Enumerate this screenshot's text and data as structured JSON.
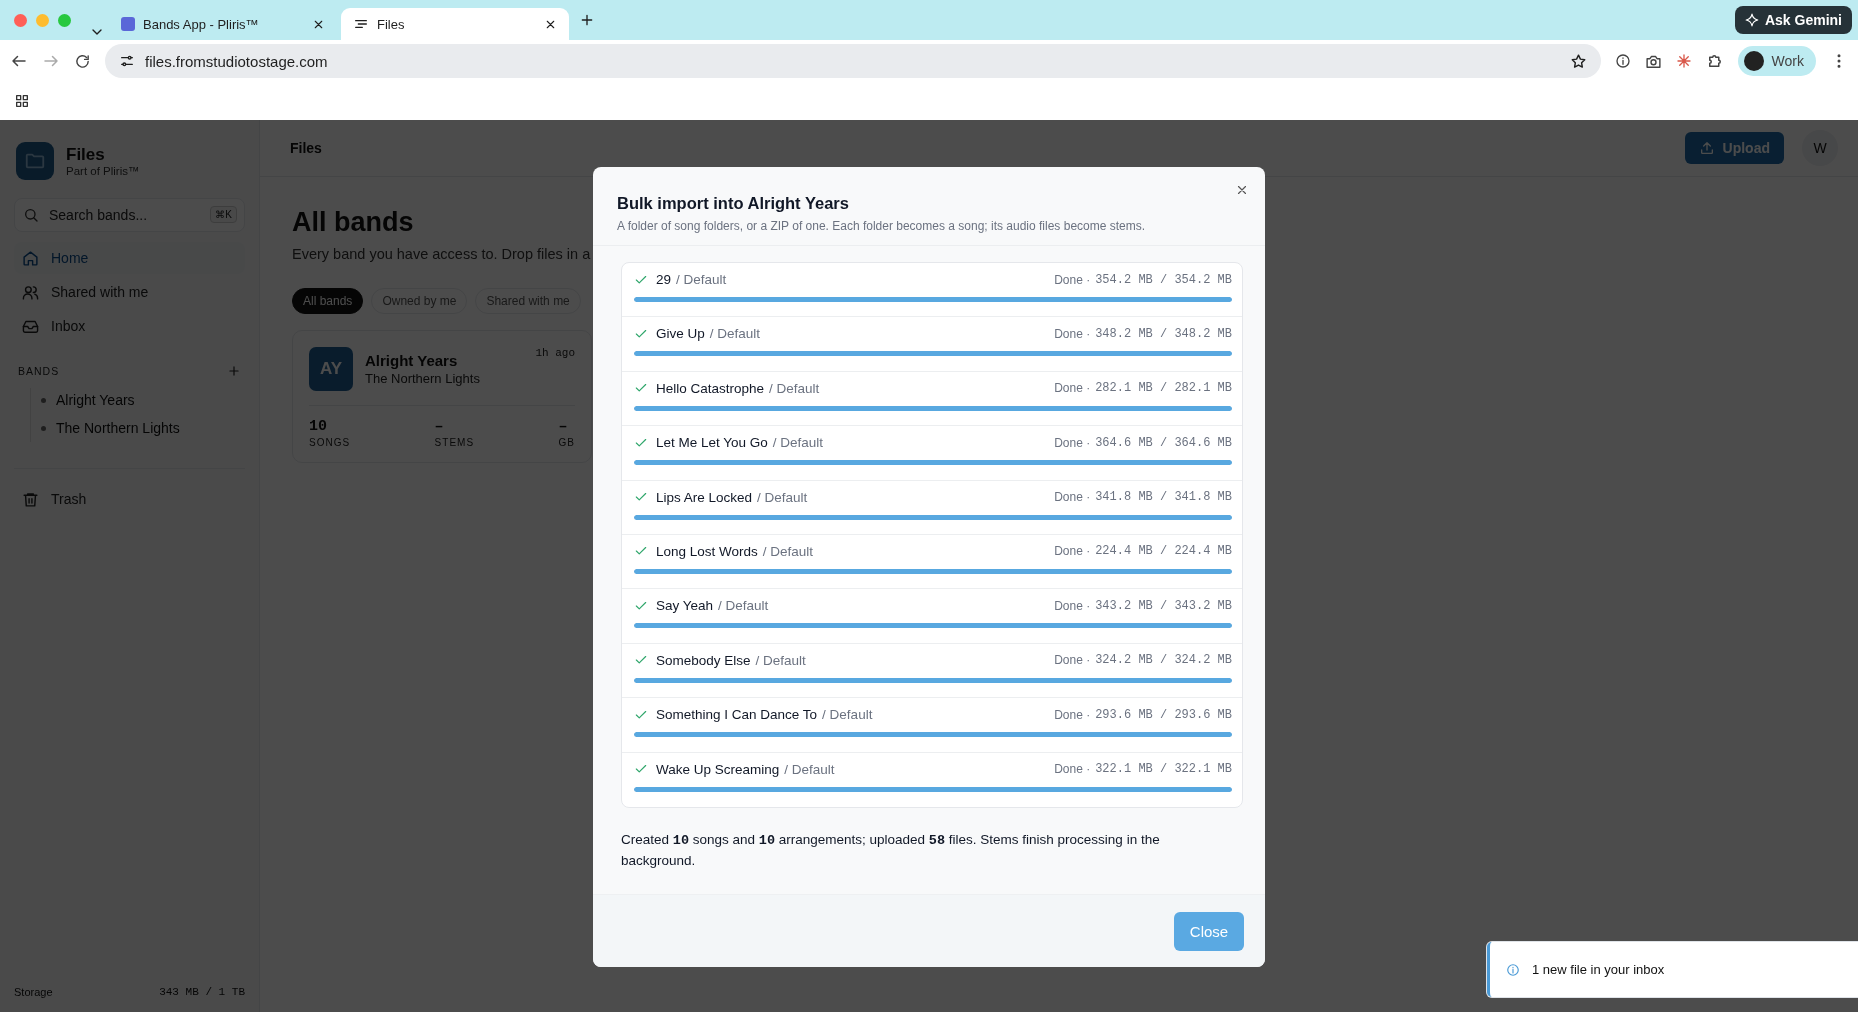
{
  "browser": {
    "tabs": [
      {
        "title": "Bands App - Pliris™",
        "selected": false
      },
      {
        "title": "Files",
        "selected": true
      }
    ],
    "url": "files.fromstudiotostage.com",
    "gemini": "Ask Gemini",
    "profile": "Work"
  },
  "sidebar": {
    "app_name": "Files",
    "app_sub": "Part of Pliris™",
    "search": {
      "placeholder": "Search bands...",
      "shortcut": "⌘K"
    },
    "nav": [
      {
        "label": "Home",
        "selected": true
      },
      {
        "label": "Shared with me",
        "selected": false
      },
      {
        "label": "Inbox",
        "selected": false
      }
    ],
    "bands_heading": "BANDS",
    "bands": [
      "Alright Years",
      "The Northern Lights"
    ],
    "trash": "Trash",
    "storage_label": "Storage",
    "storage_value": "343 MB / 1 TB"
  },
  "main": {
    "breadcrumb": "Files",
    "upload": "Upload",
    "avatar": "W",
    "title": "All bands",
    "subtitle": "Every band you have access to. Drop files in a",
    "filters": [
      {
        "label": "All bands",
        "selected": true
      },
      {
        "label": "Owned by me",
        "selected": false
      },
      {
        "label": "Shared with me",
        "selected": false
      }
    ],
    "card": {
      "initials": "AY",
      "name": "Alright Years",
      "sub": "The Northern Lights",
      "time": "1h ago",
      "stats": [
        {
          "value": "10",
          "label": "SONGS"
        },
        {
          "value": "–",
          "label": "STEMS"
        },
        {
          "value": "–",
          "label": "GB"
        }
      ]
    }
  },
  "dialog": {
    "title": "Bulk import into Alright Years",
    "subtitle": "A folder of song folders, or a ZIP of one. Each folder becomes a song; its audio files become stems.",
    "items": [
      {
        "name": "29",
        "arrangement": "/ Default",
        "status": "Done ·",
        "size": "354.2 MB / 354.2 MB",
        "done": true,
        "level": 1
      },
      {
        "name": "Give Up",
        "arrangement": "/ Default",
        "status": "Done ·",
        "size": "348.2 MB / 348.2 MB",
        "done": true,
        "level": 1
      },
      {
        "name": "Hello Catastrophe",
        "arrangement": "/ Default",
        "status": "Done ·",
        "size": "282.1 MB / 282.1 MB",
        "done": true,
        "level": 1
      },
      {
        "name": "Let Me Let You Go",
        "arrangement": "/ Default",
        "status": "Done ·",
        "size": "364.6 MB / 364.6 MB",
        "done": true,
        "level": 1
      },
      {
        "name": "Lips Are Locked",
        "arrangement": "/ Default",
        "status": "Done ·",
        "size": "341.8 MB / 341.8 MB",
        "done": true,
        "level": 1
      },
      {
        "name": "Long Lost Words",
        "arrangement": "/ Default",
        "status": "Done ·",
        "size": "224.4 MB / 224.4 MB",
        "done": true,
        "level": 1
      },
      {
        "name": "Say Yeah",
        "arrangement": "/ Default",
        "status": "Done ·",
        "size": "343.2 MB / 343.2 MB",
        "done": true,
        "level": 1
      },
      {
        "name": "Somebody Else",
        "arrangement": "/ Default",
        "status": "Done ·",
        "size": "324.2 MB / 324.2 MB",
        "done": true,
        "level": 1
      },
      {
        "name": "Something I Can Dance To",
        "arrangement": "/ Default",
        "status": "Done ·",
        "size": "293.6 MB / 293.6 MB",
        "done": true,
        "level": 1
      },
      {
        "name": "Wake Up Screaming",
        "arrangement": "/ Default",
        "status": "Done ·",
        "size": "322.1 MB / 322.1 MB",
        "done": true,
        "level": 1
      }
    ],
    "summary": "Created **10** songs and **10** arrangements; uploaded **58** files. Stems finish processing in the background.",
    "close": "Close"
  },
  "toast": {
    "text": "1 new file in your inbox"
  }
}
